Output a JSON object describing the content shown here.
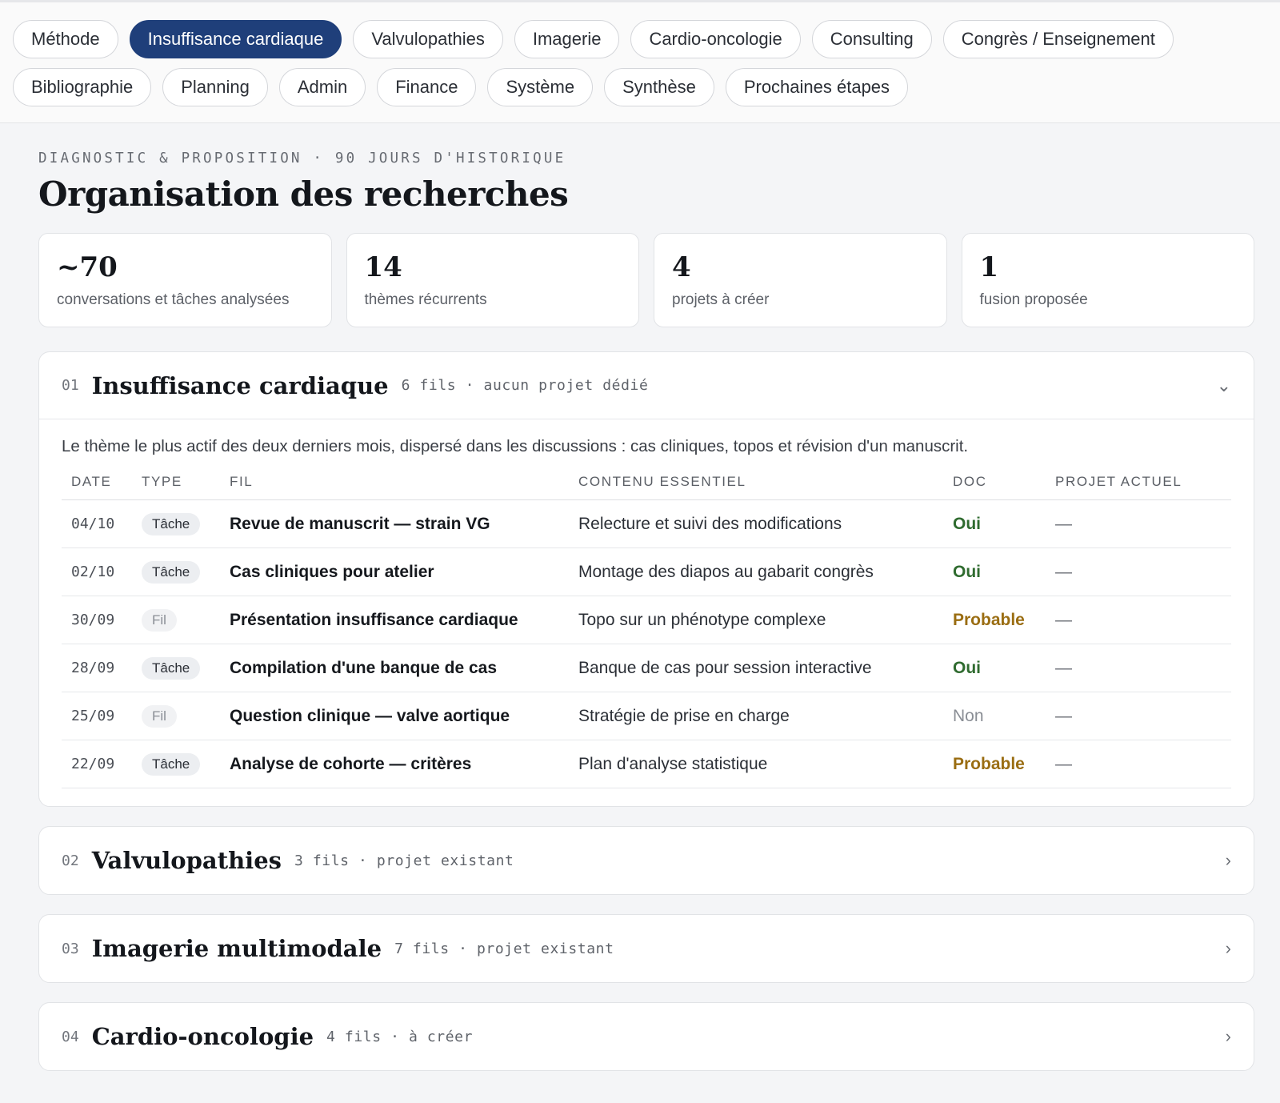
{
  "nav": {
    "row1": [
      "Méthode",
      "Insuffisance cardiaque",
      "Valvulopathies",
      "Imagerie",
      "Cardio-oncologie",
      "Consulting",
      "Congrès / Enseignement"
    ],
    "row2": [
      "Bibliographie",
      "Planning",
      "Admin",
      "Finance",
      "Système",
      "Synthèse",
      "Prochaines étapes"
    ],
    "active": "Insuffisance cardiaque"
  },
  "header": {
    "eyebrow": "DIAGNOSTIC & PROPOSITION · 90 JOURS D'HISTORIQUE",
    "title": "Organisation des recherches"
  },
  "stats": [
    {
      "value": "~70",
      "label": "conversations et tâches analysées"
    },
    {
      "value": "14",
      "label": "thèmes récurrents"
    },
    {
      "value": "4",
      "label": "projets à créer"
    },
    {
      "value": "1",
      "label": "fusion proposée"
    }
  ],
  "sections": [
    {
      "num": "01",
      "title": "Insuffisance cardiaque",
      "meta": "6 fils · aucun projet dédié",
      "expanded": true,
      "chevron": "chevron-down-icon",
      "description": "Le thème le plus actif des deux derniers mois, dispersé dans les discussions : cas cliniques, topos et révision d'un manuscrit.",
      "columns": [
        "DATE",
        "TYPE",
        "FIL",
        "CONTENU ESSENTIEL",
        "DOC",
        "PROJET ACTUEL"
      ],
      "rows": [
        {
          "date": "04/10",
          "type": "Tâche",
          "fil": "Revue de manuscrit — strain VG",
          "contenu": "Relecture et suivi des modifications",
          "doc": "Oui",
          "projet": "—"
        },
        {
          "date": "02/10",
          "type": "Tâche",
          "fil": "Cas cliniques pour atelier",
          "contenu": "Montage des diapos au gabarit congrès",
          "doc": "Oui",
          "projet": "—"
        },
        {
          "date": "30/09",
          "type": "Fil",
          "fil": "Présentation insuffisance cardiaque",
          "contenu": "Topo sur un phénotype complexe",
          "doc": "Probable",
          "projet": "—"
        },
        {
          "date": "28/09",
          "type": "Tâche",
          "fil": "Compilation d'une banque de cas",
          "contenu": "Banque de cas pour session interactive",
          "doc": "Oui",
          "projet": "—"
        },
        {
          "date": "25/09",
          "type": "Fil",
          "fil": "Question clinique — valve aortique",
          "contenu": "Stratégie de prise en charge",
          "doc": "Non",
          "projet": "—"
        },
        {
          "date": "22/09",
          "type": "Tâche",
          "fil": "Analyse de cohorte — critères",
          "contenu": "Plan d'analyse statistique",
          "doc": "Probable",
          "projet": "—"
        }
      ]
    },
    {
      "num": "02",
      "title": "Valvulopathies",
      "meta": "3 fils · projet existant",
      "expanded": false,
      "chevron": "chevron-right-icon"
    },
    {
      "num": "03",
      "title": "Imagerie multimodale",
      "meta": "7 fils · projet existant",
      "expanded": false,
      "chevron": "chevron-right-icon"
    },
    {
      "num": "04",
      "title": "Cardio-oncologie",
      "meta": "4 fils · à créer",
      "expanded": false,
      "chevron": "chevron-right-icon"
    }
  ],
  "icons": {
    "chevron_down": "⌄",
    "chevron_right": "›"
  },
  "colors": {
    "accent": "#1f3f7a",
    "doc_oui": "#2f6b2f",
    "doc_probable": "#9a6d12",
    "doc_non": "#8a8e95"
  }
}
